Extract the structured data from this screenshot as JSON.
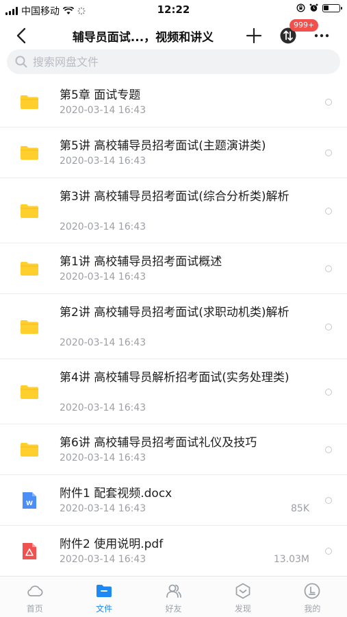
{
  "status_bar": {
    "carrier": "中国移动",
    "time": "12:22"
  },
  "nav": {
    "title": "辅导员面试...，视频和讲义",
    "badge": "999+"
  },
  "search": {
    "placeholder": "搜索网盘文件"
  },
  "files": [
    {
      "type": "folder",
      "name": "第5章  面试专题",
      "date": "2020-03-14 16:43",
      "size": ""
    },
    {
      "type": "folder",
      "name": "第5讲 高校辅导员招考面试(主题演讲类)",
      "date": "2020-03-14 16:43",
      "size": ""
    },
    {
      "type": "folder",
      "name": "第3讲 高校辅导员招考面试(综合分析类)解析",
      "date": "2020-03-14 16:43",
      "size": ""
    },
    {
      "type": "folder",
      "name": "第1讲 高校辅导员招考面试概述",
      "date": "2020-03-14 16:43",
      "size": ""
    },
    {
      "type": "folder",
      "name": "第2讲 高校辅导员招考面试(求职动机类)解析",
      "date": "2020-03-14 16:43",
      "size": ""
    },
    {
      "type": "folder",
      "name": "第4讲 高校辅导员解析招考面试(实务处理类)",
      "date": "2020-03-14 16:43",
      "size": ""
    },
    {
      "type": "folder",
      "name": "第6讲 高校辅导员招考面试礼仪及技巧",
      "date": "2020-03-14 16:43",
      "size": ""
    },
    {
      "type": "docx",
      "name": "附件1  配套视频.docx",
      "date": "2020-03-14 16:43",
      "size": "85K"
    },
    {
      "type": "pdf",
      "name": "附件2  使用说明.pdf",
      "date": "2020-03-14 16:43",
      "size": "13.03M"
    }
  ],
  "tabs": [
    {
      "label": "首页",
      "icon": "cloud-icon",
      "active": false
    },
    {
      "label": "文件",
      "icon": "folder-icon",
      "active": true
    },
    {
      "label": "好友",
      "icon": "friends-icon",
      "active": false
    },
    {
      "label": "发现",
      "icon": "discover-icon",
      "active": false
    },
    {
      "label": "我的",
      "icon": "profile-icon",
      "active": false
    }
  ],
  "colors": {
    "accent": "#1e88f5",
    "folder": "#ffcf2e",
    "badge": "#f2504d",
    "docx": "#4c8ef7",
    "pdf": "#f0524f"
  }
}
